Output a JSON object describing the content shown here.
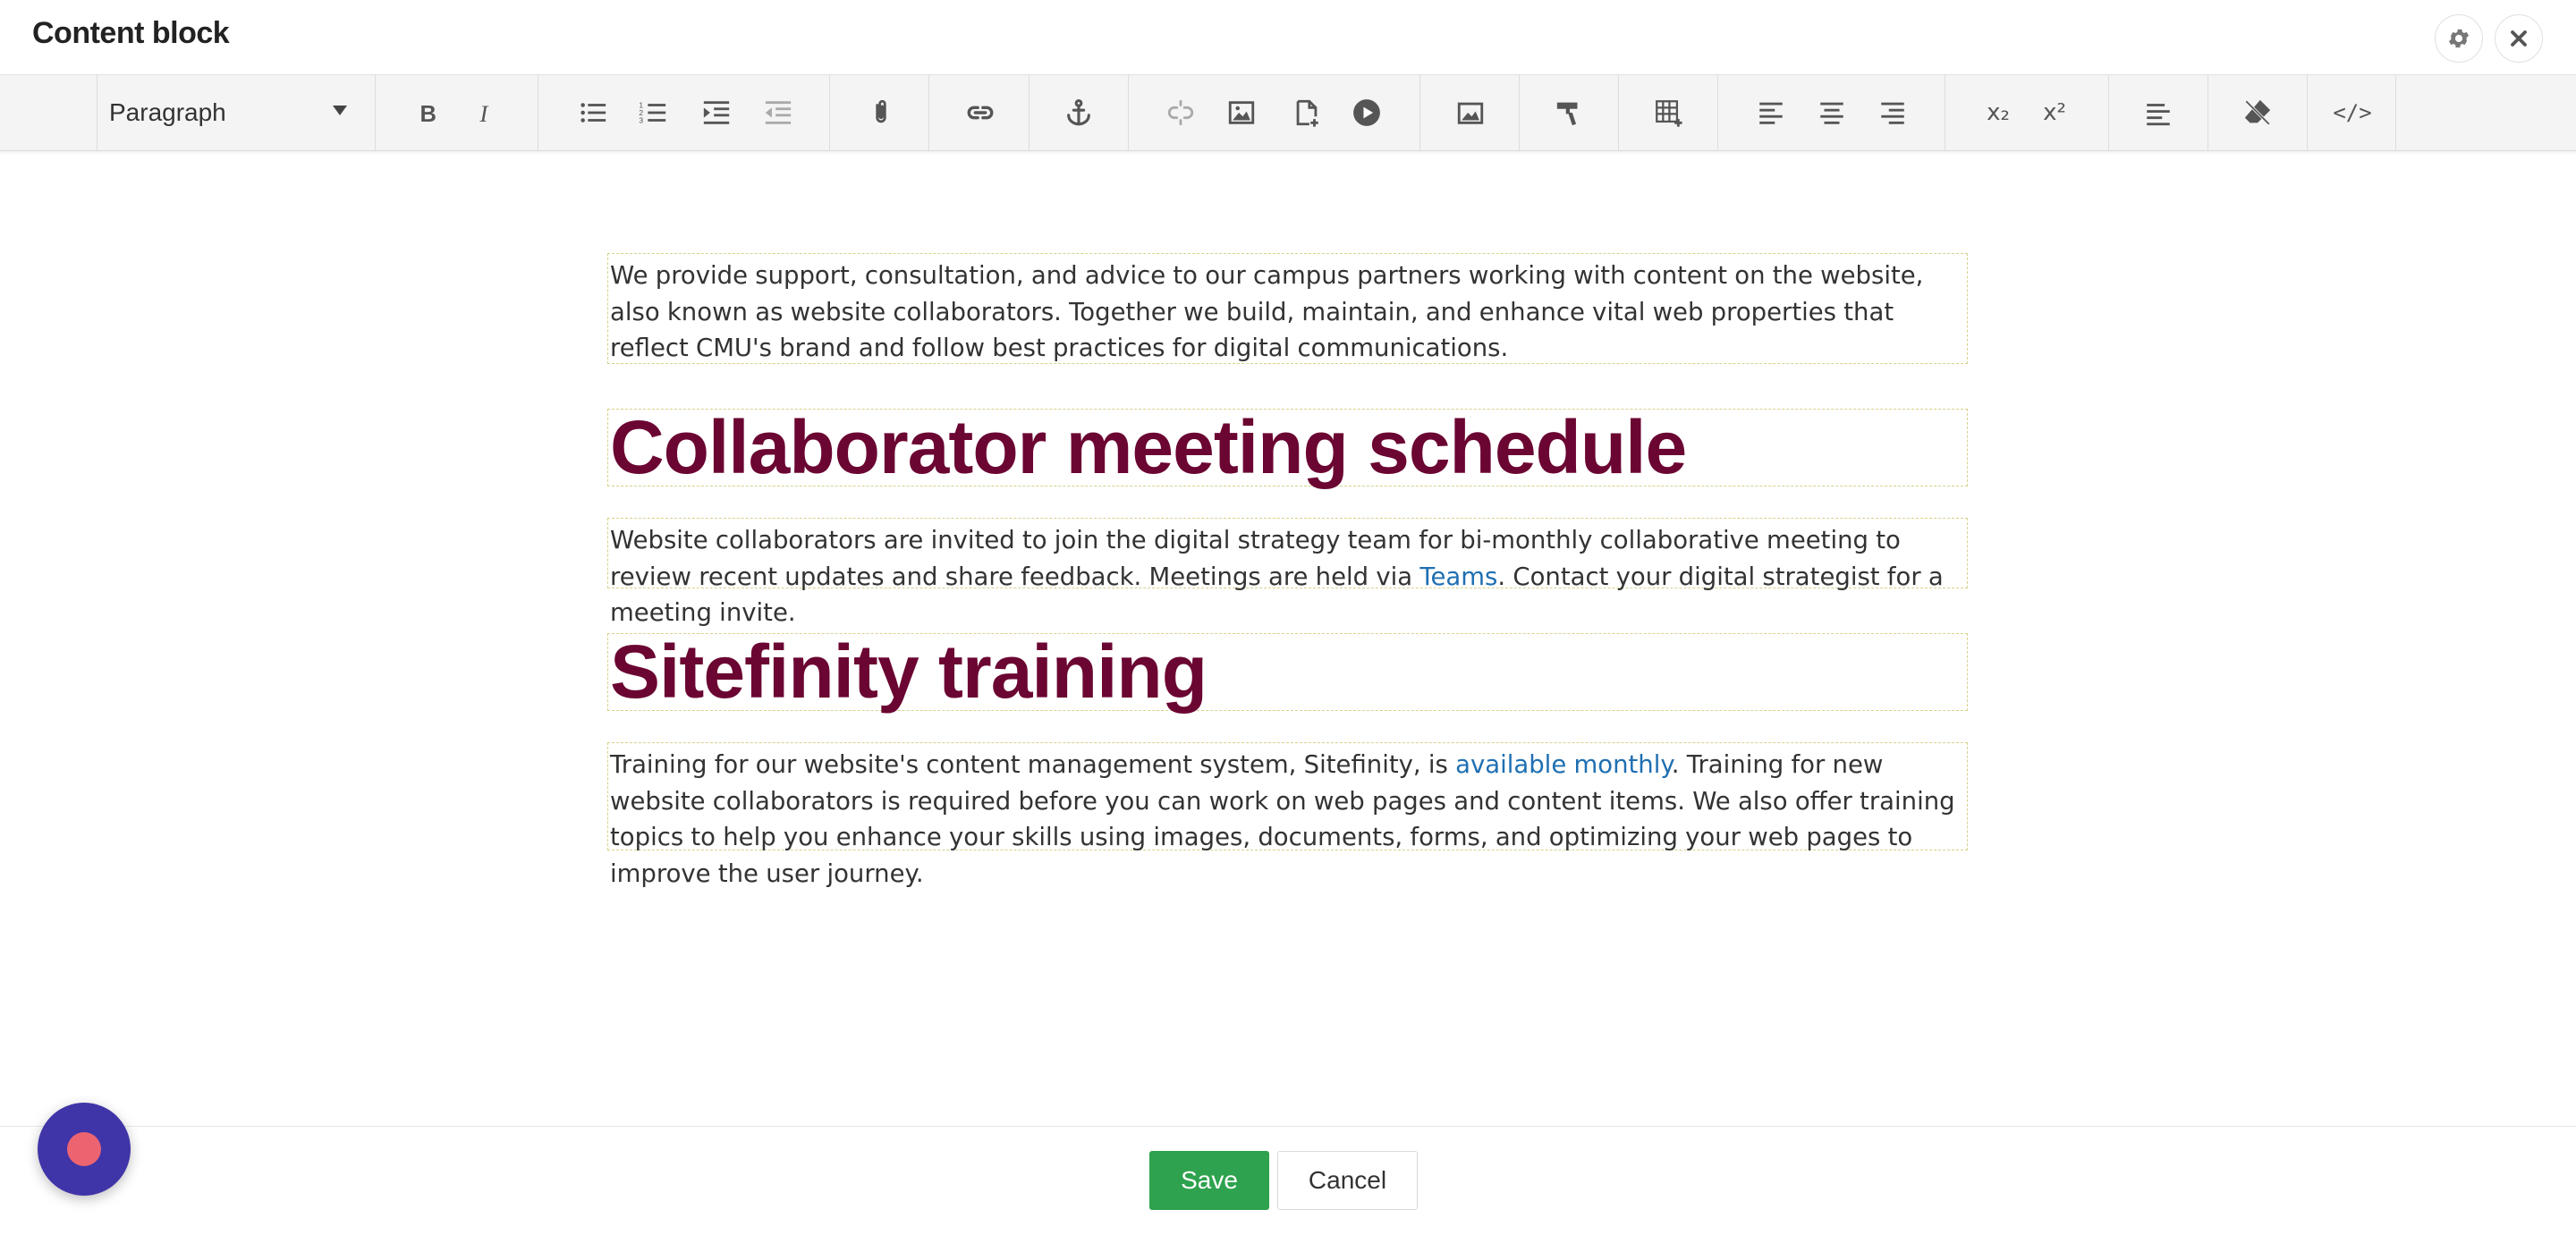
{
  "header": {
    "title": "Content block"
  },
  "toolbar": {
    "format_value": "Paragraph",
    "subscript_label": "x₂",
    "superscript_label": "x²",
    "source_label": "</>"
  },
  "content": {
    "para1": "We provide support, consultation, and advice to our campus partners working with content on the website, also known as website collaborators. Together we build, maintain, and enhance vital web properties that reflect CMU's brand and follow best practices for digital communications.",
    "heading1": "Collaborator meeting schedule",
    "para2_before": "Website collaborators are invited to join the digital strategy team for bi-monthly collaborative meeting to review recent updates and share feedback. Meetings are held via ",
    "para2_link": "Teams",
    "para2_after": ". Contact your digital strategist for a meeting invite.",
    "heading2": "Sitefinity training",
    "para3_before": "Training for our website's content management system, Sitefinity, is ",
    "para3_link": "available monthly",
    "para3_after": ". Training for new website collaborators is required before you can work on web pages and content items. We also offer training topics to help you enhance your skills using images, documents, forms, and optimizing your web pages to improve the user journey."
  },
  "footer": {
    "save_label": "Save",
    "cancel_label": "Cancel"
  },
  "colors": {
    "heading": "#6b0532",
    "link": "#1f6fb2",
    "save": "#2ea24e",
    "record_button": "#3f35a8"
  }
}
